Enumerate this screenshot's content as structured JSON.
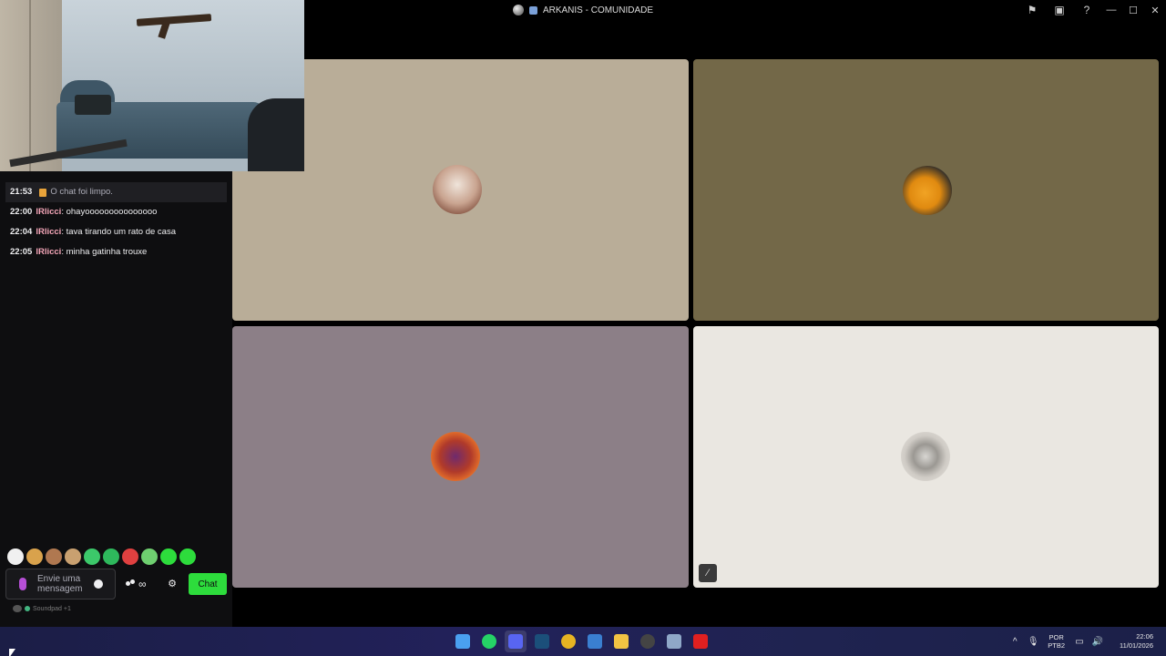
{
  "window": {
    "title": "ARKANIS - COMUNIDADE"
  },
  "chat": {
    "system_message": {
      "time": "21:53",
      "text": "O chat foi limpo."
    },
    "messages": [
      {
        "time": "22:00",
        "user": "lRlicci",
        "text": "ohayooooooooooooooo"
      },
      {
        "time": "22:04",
        "user": "lRlicci",
        "text": "tava tirando um rato de casa"
      },
      {
        "time": "22:05",
        "user": "lRlicci",
        "text": "minha gatinha trouxe"
      }
    ],
    "input_placeholder": "Envie uma mensagem",
    "bits_label": "∞",
    "send_label": "Chat",
    "soundpad_label": "Soundpad +1",
    "emotes": [
      "#f0f0f0",
      "#d9a24c",
      "#b07850",
      "#c9a070",
      "#3cc86a",
      "#2eb85c",
      "#e04040",
      "#6fcf70",
      "#2ddc3c",
      "#2ddc3c"
    ]
  },
  "tiles": [
    {
      "name": "participant-1",
      "color": "#b9ad98",
      "muted": false
    },
    {
      "name": "participant-2",
      "color": "#736848",
      "muted": false
    },
    {
      "name": "participant-3",
      "color": "#8c7f87",
      "muted": false
    },
    {
      "name": "participant-4",
      "color": "#eae7e1",
      "muted": true
    }
  ],
  "taskbar": {
    "apps": [
      {
        "name": "start",
        "color": "#4aa0f0"
      },
      {
        "name": "whatsapp",
        "color": "#25d366"
      },
      {
        "name": "discord",
        "color": "#5865f2"
      },
      {
        "name": "steam",
        "color": "#1b4f7a"
      },
      {
        "name": "chrome",
        "color": "#e6b422"
      },
      {
        "name": "mail",
        "color": "#3a7fd0"
      },
      {
        "name": "file-explorer",
        "color": "#f2c443"
      },
      {
        "name": "obs",
        "color": "#444"
      },
      {
        "name": "settings",
        "color": "#8fa8c8"
      },
      {
        "name": "youtube",
        "color": "#e02020"
      }
    ],
    "lang_line1": "POR",
    "lang_line2": "PTB2",
    "time": "22:06",
    "date": "11/01/2026"
  }
}
